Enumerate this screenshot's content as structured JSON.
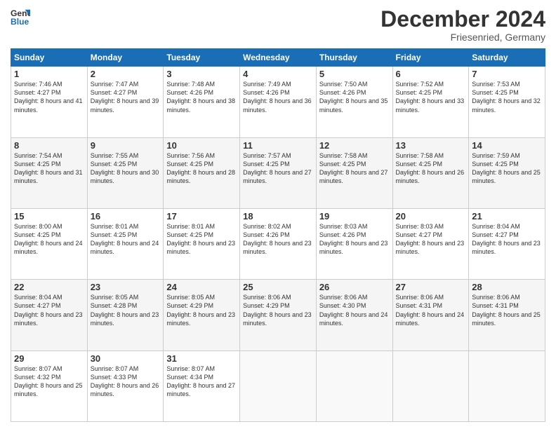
{
  "header": {
    "logo_line1": "General",
    "logo_line2": "Blue",
    "main_title": "December 2024",
    "subtitle": "Friesenried, Germany"
  },
  "weekdays": [
    "Sunday",
    "Monday",
    "Tuesday",
    "Wednesday",
    "Thursday",
    "Friday",
    "Saturday"
  ],
  "weeks": [
    [
      {
        "day": "1",
        "sunrise": "Sunrise: 7:46 AM",
        "sunset": "Sunset: 4:27 PM",
        "daylight": "Daylight: 8 hours and 41 minutes."
      },
      {
        "day": "2",
        "sunrise": "Sunrise: 7:47 AM",
        "sunset": "Sunset: 4:27 PM",
        "daylight": "Daylight: 8 hours and 39 minutes."
      },
      {
        "day": "3",
        "sunrise": "Sunrise: 7:48 AM",
        "sunset": "Sunset: 4:26 PM",
        "daylight": "Daylight: 8 hours and 38 minutes."
      },
      {
        "day": "4",
        "sunrise": "Sunrise: 7:49 AM",
        "sunset": "Sunset: 4:26 PM",
        "daylight": "Daylight: 8 hours and 36 minutes."
      },
      {
        "day": "5",
        "sunrise": "Sunrise: 7:50 AM",
        "sunset": "Sunset: 4:26 PM",
        "daylight": "Daylight: 8 hours and 35 minutes."
      },
      {
        "day": "6",
        "sunrise": "Sunrise: 7:52 AM",
        "sunset": "Sunset: 4:25 PM",
        "daylight": "Daylight: 8 hours and 33 minutes."
      },
      {
        "day": "7",
        "sunrise": "Sunrise: 7:53 AM",
        "sunset": "Sunset: 4:25 PM",
        "daylight": "Daylight: 8 hours and 32 minutes."
      }
    ],
    [
      {
        "day": "8",
        "sunrise": "Sunrise: 7:54 AM",
        "sunset": "Sunset: 4:25 PM",
        "daylight": "Daylight: 8 hours and 31 minutes."
      },
      {
        "day": "9",
        "sunrise": "Sunrise: 7:55 AM",
        "sunset": "Sunset: 4:25 PM",
        "daylight": "Daylight: 8 hours and 30 minutes."
      },
      {
        "day": "10",
        "sunrise": "Sunrise: 7:56 AM",
        "sunset": "Sunset: 4:25 PM",
        "daylight": "Daylight: 8 hours and 28 minutes."
      },
      {
        "day": "11",
        "sunrise": "Sunrise: 7:57 AM",
        "sunset": "Sunset: 4:25 PM",
        "daylight": "Daylight: 8 hours and 27 minutes."
      },
      {
        "day": "12",
        "sunrise": "Sunrise: 7:58 AM",
        "sunset": "Sunset: 4:25 PM",
        "daylight": "Daylight: 8 hours and 27 minutes."
      },
      {
        "day": "13",
        "sunrise": "Sunrise: 7:58 AM",
        "sunset": "Sunset: 4:25 PM",
        "daylight": "Daylight: 8 hours and 26 minutes."
      },
      {
        "day": "14",
        "sunrise": "Sunrise: 7:59 AM",
        "sunset": "Sunset: 4:25 PM",
        "daylight": "Daylight: 8 hours and 25 minutes."
      }
    ],
    [
      {
        "day": "15",
        "sunrise": "Sunrise: 8:00 AM",
        "sunset": "Sunset: 4:25 PM",
        "daylight": "Daylight: 8 hours and 24 minutes."
      },
      {
        "day": "16",
        "sunrise": "Sunrise: 8:01 AM",
        "sunset": "Sunset: 4:25 PM",
        "daylight": "Daylight: 8 hours and 24 minutes."
      },
      {
        "day": "17",
        "sunrise": "Sunrise: 8:01 AM",
        "sunset": "Sunset: 4:25 PM",
        "daylight": "Daylight: 8 hours and 23 minutes."
      },
      {
        "day": "18",
        "sunrise": "Sunrise: 8:02 AM",
        "sunset": "Sunset: 4:26 PM",
        "daylight": "Daylight: 8 hours and 23 minutes."
      },
      {
        "day": "19",
        "sunrise": "Sunrise: 8:03 AM",
        "sunset": "Sunset: 4:26 PM",
        "daylight": "Daylight: 8 hours and 23 minutes."
      },
      {
        "day": "20",
        "sunrise": "Sunrise: 8:03 AM",
        "sunset": "Sunset: 4:27 PM",
        "daylight": "Daylight: 8 hours and 23 minutes."
      },
      {
        "day": "21",
        "sunrise": "Sunrise: 8:04 AM",
        "sunset": "Sunset: 4:27 PM",
        "daylight": "Daylight: 8 hours and 23 minutes."
      }
    ],
    [
      {
        "day": "22",
        "sunrise": "Sunrise: 8:04 AM",
        "sunset": "Sunset: 4:27 PM",
        "daylight": "Daylight: 8 hours and 23 minutes."
      },
      {
        "day": "23",
        "sunrise": "Sunrise: 8:05 AM",
        "sunset": "Sunset: 4:28 PM",
        "daylight": "Daylight: 8 hours and 23 minutes."
      },
      {
        "day": "24",
        "sunrise": "Sunrise: 8:05 AM",
        "sunset": "Sunset: 4:29 PM",
        "daylight": "Daylight: 8 hours and 23 minutes."
      },
      {
        "day": "25",
        "sunrise": "Sunrise: 8:06 AM",
        "sunset": "Sunset: 4:29 PM",
        "daylight": "Daylight: 8 hours and 23 minutes."
      },
      {
        "day": "26",
        "sunrise": "Sunrise: 8:06 AM",
        "sunset": "Sunset: 4:30 PM",
        "daylight": "Daylight: 8 hours and 24 minutes."
      },
      {
        "day": "27",
        "sunrise": "Sunrise: 8:06 AM",
        "sunset": "Sunset: 4:31 PM",
        "daylight": "Daylight: 8 hours and 24 minutes."
      },
      {
        "day": "28",
        "sunrise": "Sunrise: 8:06 AM",
        "sunset": "Sunset: 4:31 PM",
        "daylight": "Daylight: 8 hours and 25 minutes."
      }
    ],
    [
      {
        "day": "29",
        "sunrise": "Sunrise: 8:07 AM",
        "sunset": "Sunset: 4:32 PM",
        "daylight": "Daylight: 8 hours and 25 minutes."
      },
      {
        "day": "30",
        "sunrise": "Sunrise: 8:07 AM",
        "sunset": "Sunset: 4:33 PM",
        "daylight": "Daylight: 8 hours and 26 minutes."
      },
      {
        "day": "31",
        "sunrise": "Sunrise: 8:07 AM",
        "sunset": "Sunset: 4:34 PM",
        "daylight": "Daylight: 8 hours and 27 minutes."
      },
      null,
      null,
      null,
      null
    ]
  ]
}
